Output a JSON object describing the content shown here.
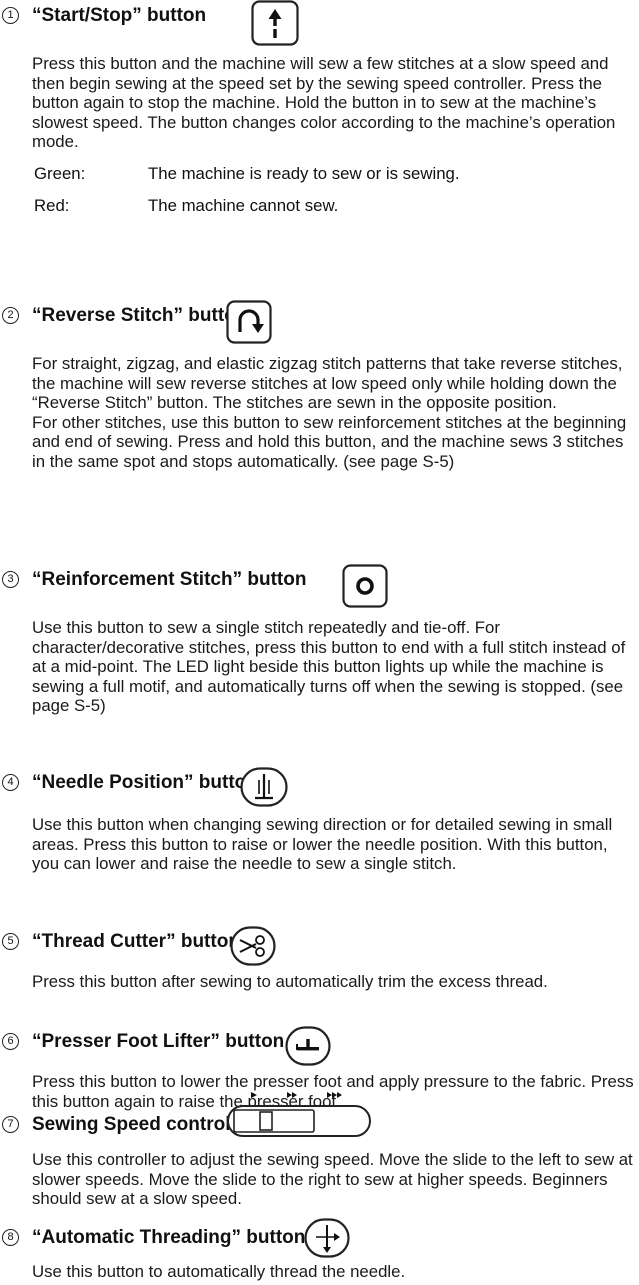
{
  "items": [
    {
      "number": "1",
      "title": "“Start/Stop” button",
      "icon": "start-stop-icon",
      "paragraphs": [
        "Press this button and the machine will sew a few stitches at a slow speed and then begin sewing at the speed set by the sewing speed controller. Press the button again to stop the machine. Hold the button in to sew at the machine’s slowest speed. The button changes color according to the machine’s operation mode."
      ],
      "modes": [
        {
          "name": "Green:",
          "description": "The machine is ready to sew or is sewing."
        },
        {
          "name": "Red:",
          "description": "The machine cannot sew."
        }
      ]
    },
    {
      "number": "2",
      "title": "“Reverse Stitch” button",
      "icon": "reverse-stitch-icon",
      "paragraphs": [
        "For straight, zigzag, and elastic zigzag stitch patterns that take reverse stitches, the machine will sew reverse stitches at low speed only while holding down the “Reverse Stitch” button. The stitches are sewn in the opposite position.",
        "For other stitches, use this button to sew reinforcement stitches at the beginning and end of sewing. Press and hold this button, and the machine sews 3 stitches in the same spot and stops automatically. (see page S-5)"
      ]
    },
    {
      "number": "3",
      "title": "“Reinforcement Stitch” button",
      "icon": "reinforcement-stitch-icon",
      "paragraphs": [
        "Use this button to sew a single stitch repeatedly and tie-off. For character/decorative stitches, press this button to end with a full stitch instead of at a mid-point. The LED light beside this button lights up while the machine is sewing a full motif, and automatically turns off when the sewing is stopped. (see page S-5)"
      ]
    },
    {
      "number": "4",
      "title": "“Needle Position” button",
      "icon": "needle-position-icon",
      "paragraphs": [
        "Use this button when changing sewing direction or for detailed sewing in small areas. Press this button to raise or lower the needle position. With this button, you can lower and raise the needle to sew a single stitch."
      ]
    },
    {
      "number": "5",
      "title": "“Thread Cutter” button",
      "icon": "thread-cutter-icon",
      "paragraphs": [
        "Press this button after sewing to automatically trim the excess thread."
      ]
    },
    {
      "number": "6",
      "title": "“Presser Foot Lifter” button",
      "icon": "presser-foot-lifter-icon",
      "paragraphs": [
        "Press this button to lower the presser foot and apply pressure to the fabric. Press this button again to raise the presser foot."
      ]
    },
    {
      "number": "7",
      "title": "Sewing Speed controller",
      "icon": "speed-slider-icon",
      "paragraphs": [
        "Use this controller to adjust the sewing speed. Move the slide to the left to sew at slower speeds. Move the slide to the right to sew at higher speeds. Beginners should sew at a slow speed."
      ]
    },
    {
      "number": "8",
      "title": "“Automatic Threading” button",
      "icon": "automatic-threading-icon",
      "paragraphs": [
        "Use this button to automatically thread the needle."
      ]
    }
  ]
}
